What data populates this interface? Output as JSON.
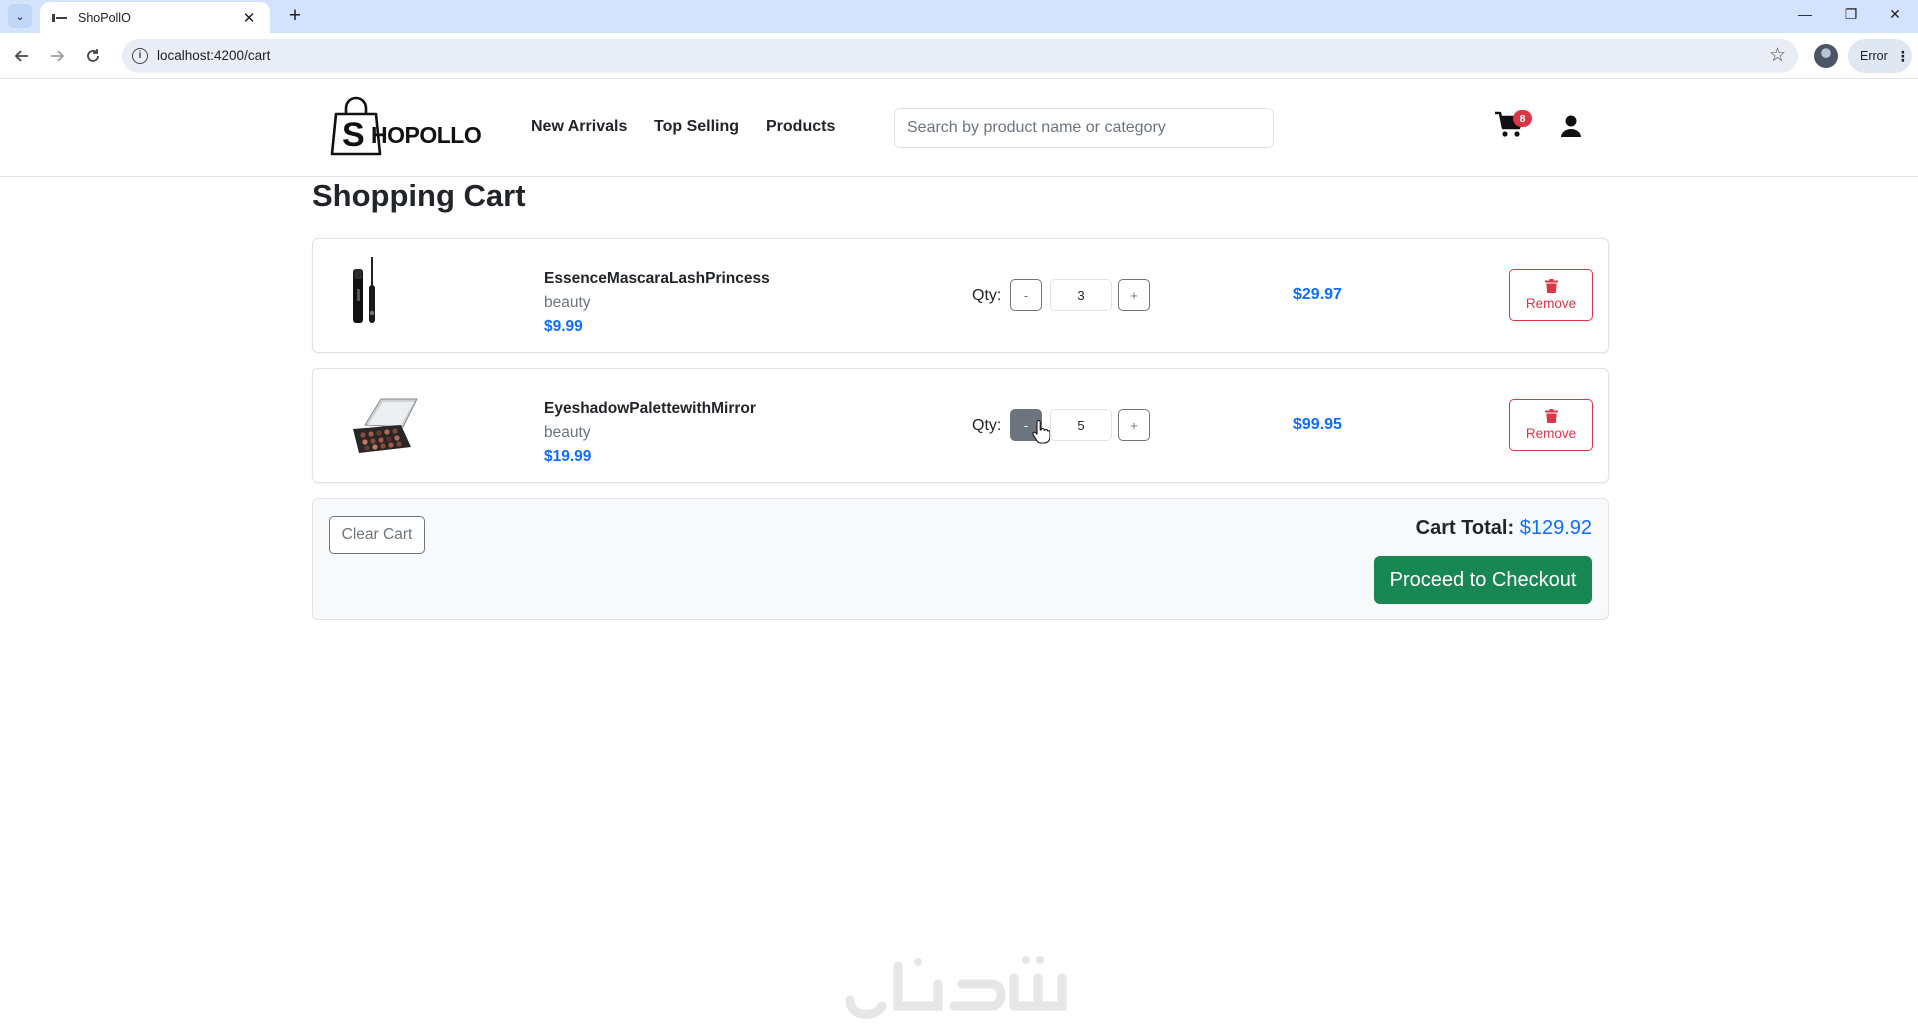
{
  "browser": {
    "tab_title": "ShoPollO",
    "tab_close_glyph": "✕",
    "new_tab_glyph": "+",
    "tab_list_glyph": "⌄",
    "url": "localhost:4200/cart",
    "profile_chip": "Error",
    "window_controls": {
      "minimize": "—",
      "restore": "❐",
      "close": "✕"
    },
    "icons": [
      "back-arrow-icon",
      "forward-arrow-icon",
      "reload-icon",
      "site-info-icon",
      "bookmark-star-icon",
      "profile-avatar",
      "more-vertical-icon"
    ]
  },
  "header": {
    "logo_text": "HOPOLLO",
    "logo_letter": "S",
    "nav": [
      {
        "label": "New Arrivals"
      },
      {
        "label": "Top Selling"
      },
      {
        "label": "Products"
      }
    ],
    "search_placeholder": "Search by product name or category",
    "cart_count": "8"
  },
  "page": {
    "title": "Shopping Cart"
  },
  "cart": {
    "qty_label": "Qty:",
    "minus_label": "-",
    "plus_label": "+",
    "remove_label": "Remove",
    "items": [
      {
        "name": "EssenceMascaraLashPrincess",
        "category": "beauty",
        "price": "$9.99",
        "quantity": "3",
        "line_total": "$29.97"
      },
      {
        "name": "EyeshadowPalettewithMirror",
        "category": "beauty",
        "price": "$19.99",
        "quantity": "5",
        "line_total": "$99.95"
      }
    ],
    "clear_label": "Clear Cart",
    "total_label": "Cart Total:",
    "total_value": "$129.92",
    "checkout_label": "Proceed to Checkout"
  },
  "colors": {
    "accent_blue": "#0d6efd",
    "danger_red": "#dc3545",
    "success_green": "#198754",
    "secondary_gray": "#6c757d",
    "chrome_tab_strip": "#d3e3fd"
  }
}
